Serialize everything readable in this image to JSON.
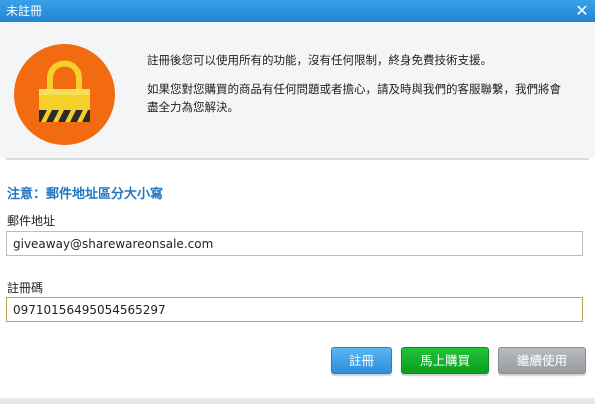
{
  "window": {
    "title": "未註冊",
    "close_icon": "close-icon"
  },
  "intro": {
    "line1": "註冊後您可以使用所有的功能，沒有任何限制，終身免費技術支援。",
    "line2": "如果您對您購買的商品有任何問題或者擔心，請及時與我們的客服聯繫，我們將會盡全力為您解決。"
  },
  "notice": "注意：郵件地址區分大小寫",
  "form": {
    "email_label": "郵件地址",
    "email_value": "giveaway@sharewareonsale.com",
    "code_label": "註冊碼",
    "code_value": "09710156495054565297"
  },
  "buttons": {
    "register": "註冊",
    "buy": "馬上購買",
    "continue": "繼續使用"
  },
  "colors": {
    "titlebar": "#2a92df",
    "lock_circle": "#f26b10",
    "lock_body": "#f5cf2a",
    "register": "#3b9ee6",
    "buy": "#13ad27",
    "continue": "#a3a7ab",
    "notice": "#2377c2"
  }
}
